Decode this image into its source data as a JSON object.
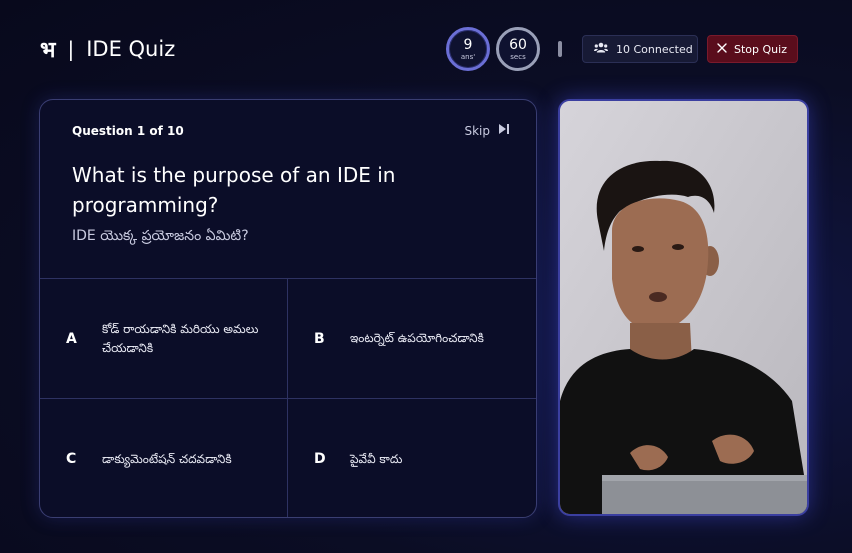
{
  "header": {
    "logo": "भ",
    "separator": "|",
    "title": "IDE Quiz",
    "answers_count": "9",
    "answers_label": "ans'",
    "seconds_count": "60",
    "seconds_label": "secs",
    "connected_label": "10 Connected",
    "stop_label": "Stop Quiz"
  },
  "question": {
    "counter": "Question 1 of 10",
    "skip_label": "Skip",
    "text": "What is the purpose of an IDE in programming?",
    "translation": "IDE యొక్క ప్రయోజనం ఏమిటి?"
  },
  "options": [
    {
      "letter": "A",
      "text": "కోడ్ రాయడానికి మరియు అమలు చేయడానికి"
    },
    {
      "letter": "B",
      "text": "ఇంటర్నెట్ ఉపయోగించడానికి"
    },
    {
      "letter": "C",
      "text": "డాక్యుమెంటేషన్ చదవడానికి"
    },
    {
      "letter": "D",
      "text": "పైవేవీ కాదు"
    }
  ],
  "colors": {
    "background": "#0b0d24",
    "accent": "#6b6fd6",
    "stop_button": "#5a0d1c",
    "card_border": "#3a3e72"
  },
  "icons": {
    "connected": "users-icon",
    "stop": "close-icon",
    "skip": "skip-forward-icon"
  }
}
